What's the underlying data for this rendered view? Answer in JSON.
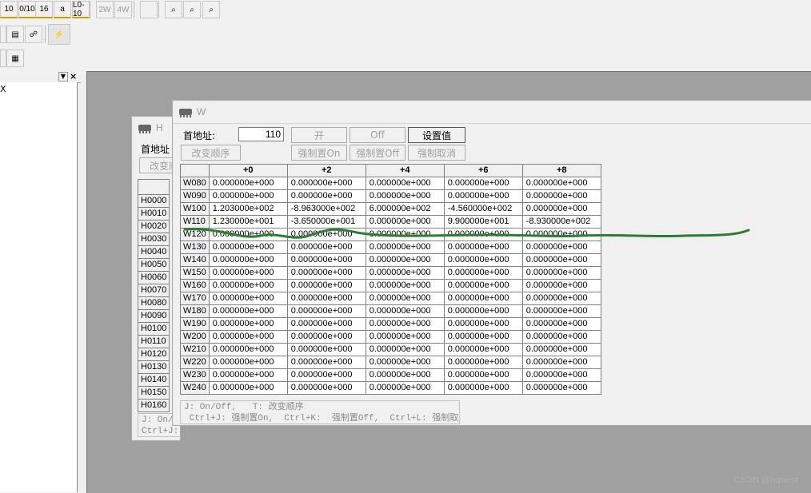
{
  "toolbar": {
    "row1": [
      {
        "label": "10"
      },
      {
        "label": "0/10"
      },
      {
        "label": "16"
      },
      {
        "label": "a"
      },
      {
        "label": "L0-10"
      },
      {
        "label": "2W"
      },
      {
        "label": "4W"
      },
      {
        "label": ""
      },
      {
        "label": "⌕"
      },
      {
        "label": "⌕"
      },
      {
        "label": "⌕"
      }
    ]
  },
  "window_h": {
    "title": "H",
    "start_label": "首地址",
    "change_order": "改变顺",
    "rows": [
      "H0000",
      "H0010",
      "H0020",
      "H0030",
      "H0040",
      "H0050",
      "H0060",
      "H0070",
      "H0080",
      "H0090",
      "H0100",
      "H0110",
      "H0120",
      "H0130",
      "H0140",
      "H0150",
      "H0160"
    ],
    "status": "J: On/Of\nCtrl+J: 强制置"
  },
  "window_w": {
    "title": "W",
    "start_label": "首地址:",
    "start_value": "110",
    "btn_on": "开",
    "btn_off": "Off",
    "btn_set": "设置值",
    "btn_change_order": "改变顺序",
    "btn_force_on": "强制置On",
    "btn_force_off": "强制置Off",
    "btn_force_cancel": "强制取消",
    "columns": [
      "+0",
      "+2",
      "+4",
      "+6",
      "+8"
    ],
    "rows": [
      {
        "addr": "W080",
        "values": [
          "0.000000e+000",
          "0.000000e+000",
          "0.000000e+000",
          "0.000000e+000",
          "0.000000e+000"
        ]
      },
      {
        "addr": "W090",
        "values": [
          "0.000000e+000",
          "0.000000e+000",
          "0.000000e+000",
          "0.000000e+000",
          "0.000000e+000"
        ]
      },
      {
        "addr": "W100",
        "values": [
          "1.203000e+002",
          "-8.963000e+002",
          "6.000000e+002",
          "-4.560000e+002",
          "0.000000e+000"
        ]
      },
      {
        "addr": "W110",
        "values": [
          "1.230000e+001",
          "-3.650000e+001",
          "0.000000e+000",
          "9.900000e+001",
          "-8.930000e+002"
        ]
      },
      {
        "addr": "W120",
        "values": [
          "0.000000e+000",
          "0.000000e+000",
          "0.000000e+000",
          "0.000000e+000",
          "0.000000e+000"
        ]
      },
      {
        "addr": "W130",
        "values": [
          "0.000000e+000",
          "0.000000e+000",
          "0.000000e+000",
          "0.000000e+000",
          "0.000000e+000"
        ]
      },
      {
        "addr": "W140",
        "values": [
          "0.000000e+000",
          "0.000000e+000",
          "0.000000e+000",
          "0.000000e+000",
          "0.000000e+000"
        ]
      },
      {
        "addr": "W150",
        "values": [
          "0.000000e+000",
          "0.000000e+000",
          "0.000000e+000",
          "0.000000e+000",
          "0.000000e+000"
        ]
      },
      {
        "addr": "W160",
        "values": [
          "0.000000e+000",
          "0.000000e+000",
          "0.000000e+000",
          "0.000000e+000",
          "0.000000e+000"
        ]
      },
      {
        "addr": "W170",
        "values": [
          "0.000000e+000",
          "0.000000e+000",
          "0.000000e+000",
          "0.000000e+000",
          "0.000000e+000"
        ]
      },
      {
        "addr": "W180",
        "values": [
          "0.000000e+000",
          "0.000000e+000",
          "0.000000e+000",
          "0.000000e+000",
          "0.000000e+000"
        ]
      },
      {
        "addr": "W190",
        "values": [
          "0.000000e+000",
          "0.000000e+000",
          "0.000000e+000",
          "0.000000e+000",
          "0.000000e+000"
        ]
      },
      {
        "addr": "W200",
        "values": [
          "0.000000e+000",
          "0.000000e+000",
          "0.000000e+000",
          "0.000000e+000",
          "0.000000e+000"
        ]
      },
      {
        "addr": "W210",
        "values": [
          "0.000000e+000",
          "0.000000e+000",
          "0.000000e+000",
          "0.000000e+000",
          "0.000000e+000"
        ]
      },
      {
        "addr": "W220",
        "values": [
          "0.000000e+000",
          "0.000000e+000",
          "0.000000e+000",
          "0.000000e+000",
          "0.000000e+000"
        ]
      },
      {
        "addr": "W230",
        "values": [
          "0.000000e+000",
          "0.000000e+000",
          "0.000000e+000",
          "0.000000e+000",
          "0.000000e+000"
        ]
      },
      {
        "addr": "W240",
        "values": [
          "0.000000e+000",
          "0.000000e+000",
          "0.000000e+000",
          "0.000000e+000",
          "0.000000e+000"
        ]
      }
    ],
    "status": "J: On/Off,   T: 改变顺序\n Ctrl+J: 强制置On,  Ctrl+K:  强制置Off,  Ctrl+L: 强制取消"
  },
  "left_pane": {
    "item": "X"
  },
  "watermark": "CSDN @hqwest",
  "colors": {
    "annotation_stroke": "#2e7d32",
    "mdi_background": "#a0a0a0"
  }
}
